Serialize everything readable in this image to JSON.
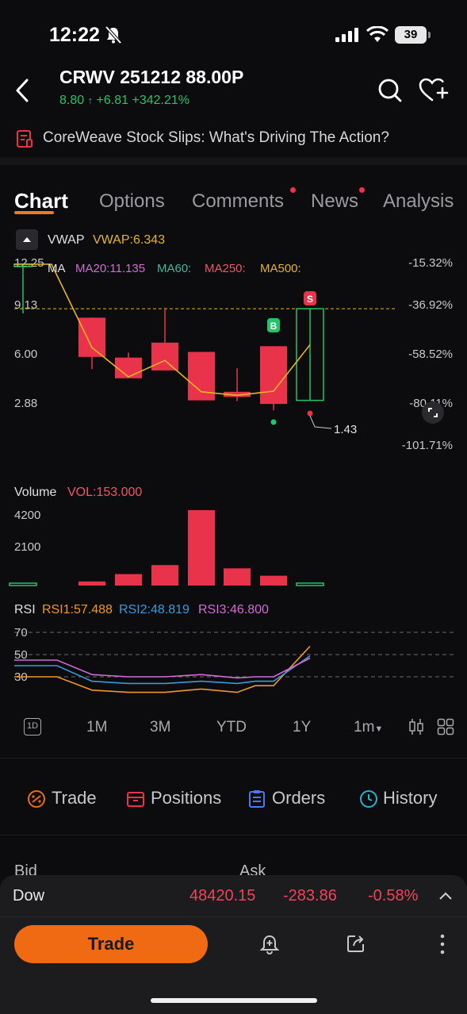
{
  "status_bar": {
    "time": "12:22",
    "battery": "39"
  },
  "header": {
    "title": "CRWV 251212 88.00P",
    "price": "8.80",
    "change": "+6.81",
    "change_pct": "+342.21%"
  },
  "news_banner": {
    "text": "CoreWeave Stock Slips: What's Driving The Action?"
  },
  "tabs": [
    {
      "label": "Chart",
      "active": true
    },
    {
      "label": "Options"
    },
    {
      "label": "Comments",
      "dot": true
    },
    {
      "label": "News",
      "dot": true
    },
    {
      "label": "Analysis"
    }
  ],
  "indicators": {
    "vwap_label": "VWAP",
    "vwap_value": "VWAP:6.343",
    "ma_label": "MA",
    "ma20": "MA20:11.135",
    "ma60": "MA60:",
    "ma250": "MA250:",
    "ma500": "MA500:"
  },
  "chart_data": [
    {
      "type": "candlestick",
      "y_ticks": [
        "12.25",
        "9.13",
        "6.00",
        "2.88"
      ],
      "right_ticks": [
        "-15.32%",
        "-36.92%",
        "-58.52%",
        "-80.11%",
        "-101.71%"
      ],
      "ylim": [
        0.62,
        12.25
      ],
      "candles": [
        {
          "open": 12.25,
          "close": 12.25,
          "high": 12.25,
          "low": 11.6,
          "color": "green"
        },
        {
          "open": 8.5,
          "close": 5.75,
          "high": 8.5,
          "low": 4.9,
          "color": "red"
        },
        {
          "open": 5.7,
          "close": 4.25,
          "high": 6.05,
          "low": 4.25,
          "color": "red"
        },
        {
          "open": 6.75,
          "close": 4.8,
          "high": 9.2,
          "low": 4.8,
          "color": "red"
        },
        {
          "open": 6.1,
          "close": 2.7,
          "high": 6.1,
          "low": 2.7,
          "color": "red"
        },
        {
          "open": 3.3,
          "close": 2.95,
          "high": 4.95,
          "low": 2.65,
          "color": "red"
        },
        {
          "open": 6.5,
          "close": 2.45,
          "high": 6.5,
          "low": 2.0,
          "color": "red"
        },
        {
          "open": 2.7,
          "close": 9.13,
          "high": 9.13,
          "low": 2.7,
          "color": "green"
        }
      ],
      "ma_line": [
        12.25,
        12.25,
        6.4,
        4.35,
        5.5,
        3.3,
        3.05,
        3.35,
        6.6
      ],
      "vwap_level": 9.13,
      "buy_marker": "B",
      "sell_marker": "S",
      "low_label": "1.43"
    },
    {
      "type": "bar",
      "label": "Volume",
      "value_label": "VOL:153.000",
      "y_ticks": [
        "4200",
        "2100"
      ],
      "ylim": [
        0,
        4600
      ],
      "values": [
        30,
        250,
        700,
        1250,
        4850,
        1050,
        600,
        150
      ],
      "colors": [
        "green",
        "red",
        "red",
        "red",
        "red",
        "red",
        "red",
        "green"
      ]
    },
    {
      "type": "line",
      "label": "RSI",
      "y_ticks": [
        "70",
        "50",
        "30"
      ],
      "ylim": [
        10,
        80
      ],
      "series": [
        {
          "name": "RSI1:57.488",
          "color": "#f0962a",
          "values": [
            30,
            30,
            30,
            18,
            16,
            16,
            19,
            16,
            22,
            22,
            57.5
          ]
        },
        {
          "name": "RSI2:48.819",
          "color": "#3a9ad8",
          "values": [
            40,
            40,
            40,
            26,
            24,
            24,
            26,
            24,
            26,
            26,
            48.8
          ]
        },
        {
          "name": "RSI3:46.800",
          "color": "#d26ad8",
          "values": [
            45,
            45,
            45,
            32,
            30,
            30,
            32,
            29,
            30,
            30,
            46.8
          ]
        }
      ]
    }
  ],
  "periods": [
    "1D",
    "1M",
    "3M",
    "YTD",
    "1Y",
    "1m"
  ],
  "actions": [
    {
      "label": "Trade"
    },
    {
      "label": "Positions"
    },
    {
      "label": "Orders"
    },
    {
      "label": "History"
    }
  ],
  "quote": {
    "bid": "Bid",
    "ask": "Ask"
  },
  "index_bar": {
    "name": "Dow",
    "price": "48420.15",
    "change": "-283.86",
    "change_pct": "-0.58%"
  },
  "bottom": {
    "trade_label": "Trade"
  },
  "colors": {
    "up": "#22c36b",
    "down": "#e8334a",
    "accent": "#f06a14",
    "vwap": "#e6b422"
  }
}
